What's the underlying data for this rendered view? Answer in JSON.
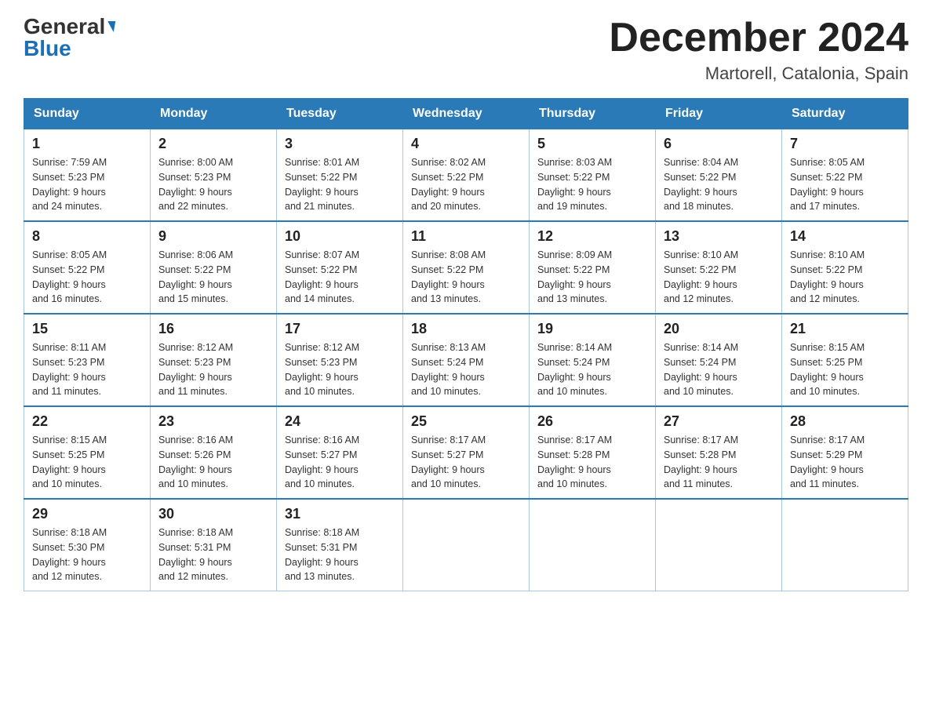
{
  "header": {
    "title": "December 2024",
    "subtitle": "Martorell, Catalonia, Spain",
    "logo_general": "General",
    "logo_blue": "Blue"
  },
  "days_of_week": [
    "Sunday",
    "Monday",
    "Tuesday",
    "Wednesday",
    "Thursday",
    "Friday",
    "Saturday"
  ],
  "weeks": [
    [
      {
        "day": "1",
        "sunrise": "7:59 AM",
        "sunset": "5:23 PM",
        "daylight": "9 hours and 24 minutes."
      },
      {
        "day": "2",
        "sunrise": "8:00 AM",
        "sunset": "5:23 PM",
        "daylight": "9 hours and 22 minutes."
      },
      {
        "day": "3",
        "sunrise": "8:01 AM",
        "sunset": "5:22 PM",
        "daylight": "9 hours and 21 minutes."
      },
      {
        "day": "4",
        "sunrise": "8:02 AM",
        "sunset": "5:22 PM",
        "daylight": "9 hours and 20 minutes."
      },
      {
        "day": "5",
        "sunrise": "8:03 AM",
        "sunset": "5:22 PM",
        "daylight": "9 hours and 19 minutes."
      },
      {
        "day": "6",
        "sunrise": "8:04 AM",
        "sunset": "5:22 PM",
        "daylight": "9 hours and 18 minutes."
      },
      {
        "day": "7",
        "sunrise": "8:05 AM",
        "sunset": "5:22 PM",
        "daylight": "9 hours and 17 minutes."
      }
    ],
    [
      {
        "day": "8",
        "sunrise": "8:05 AM",
        "sunset": "5:22 PM",
        "daylight": "9 hours and 16 minutes."
      },
      {
        "day": "9",
        "sunrise": "8:06 AM",
        "sunset": "5:22 PM",
        "daylight": "9 hours and 15 minutes."
      },
      {
        "day": "10",
        "sunrise": "8:07 AM",
        "sunset": "5:22 PM",
        "daylight": "9 hours and 14 minutes."
      },
      {
        "day": "11",
        "sunrise": "8:08 AM",
        "sunset": "5:22 PM",
        "daylight": "9 hours and 13 minutes."
      },
      {
        "day": "12",
        "sunrise": "8:09 AM",
        "sunset": "5:22 PM",
        "daylight": "9 hours and 13 minutes."
      },
      {
        "day": "13",
        "sunrise": "8:10 AM",
        "sunset": "5:22 PM",
        "daylight": "9 hours and 12 minutes."
      },
      {
        "day": "14",
        "sunrise": "8:10 AM",
        "sunset": "5:22 PM",
        "daylight": "9 hours and 12 minutes."
      }
    ],
    [
      {
        "day": "15",
        "sunrise": "8:11 AM",
        "sunset": "5:23 PM",
        "daylight": "9 hours and 11 minutes."
      },
      {
        "day": "16",
        "sunrise": "8:12 AM",
        "sunset": "5:23 PM",
        "daylight": "9 hours and 11 minutes."
      },
      {
        "day": "17",
        "sunrise": "8:12 AM",
        "sunset": "5:23 PM",
        "daylight": "9 hours and 10 minutes."
      },
      {
        "day": "18",
        "sunrise": "8:13 AM",
        "sunset": "5:24 PM",
        "daylight": "9 hours and 10 minutes."
      },
      {
        "day": "19",
        "sunrise": "8:14 AM",
        "sunset": "5:24 PM",
        "daylight": "9 hours and 10 minutes."
      },
      {
        "day": "20",
        "sunrise": "8:14 AM",
        "sunset": "5:24 PM",
        "daylight": "9 hours and 10 minutes."
      },
      {
        "day": "21",
        "sunrise": "8:15 AM",
        "sunset": "5:25 PM",
        "daylight": "9 hours and 10 minutes."
      }
    ],
    [
      {
        "day": "22",
        "sunrise": "8:15 AM",
        "sunset": "5:25 PM",
        "daylight": "9 hours and 10 minutes."
      },
      {
        "day": "23",
        "sunrise": "8:16 AM",
        "sunset": "5:26 PM",
        "daylight": "9 hours and 10 minutes."
      },
      {
        "day": "24",
        "sunrise": "8:16 AM",
        "sunset": "5:27 PM",
        "daylight": "9 hours and 10 minutes."
      },
      {
        "day": "25",
        "sunrise": "8:17 AM",
        "sunset": "5:27 PM",
        "daylight": "9 hours and 10 minutes."
      },
      {
        "day": "26",
        "sunrise": "8:17 AM",
        "sunset": "5:28 PM",
        "daylight": "9 hours and 10 minutes."
      },
      {
        "day": "27",
        "sunrise": "8:17 AM",
        "sunset": "5:28 PM",
        "daylight": "9 hours and 11 minutes."
      },
      {
        "day": "28",
        "sunrise": "8:17 AM",
        "sunset": "5:29 PM",
        "daylight": "9 hours and 11 minutes."
      }
    ],
    [
      {
        "day": "29",
        "sunrise": "8:18 AM",
        "sunset": "5:30 PM",
        "daylight": "9 hours and 12 minutes."
      },
      {
        "day": "30",
        "sunrise": "8:18 AM",
        "sunset": "5:31 PM",
        "daylight": "9 hours and 12 minutes."
      },
      {
        "day": "31",
        "sunrise": "8:18 AM",
        "sunset": "5:31 PM",
        "daylight": "9 hours and 13 minutes."
      },
      null,
      null,
      null,
      null
    ]
  ],
  "labels": {
    "sunrise": "Sunrise:",
    "sunset": "Sunset:",
    "daylight": "Daylight:"
  }
}
